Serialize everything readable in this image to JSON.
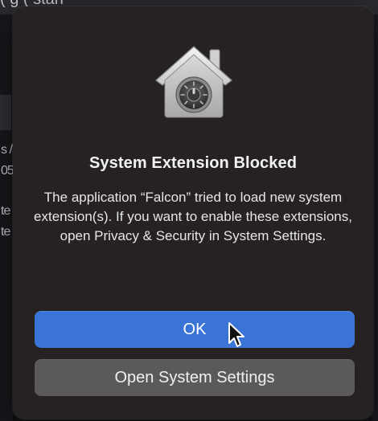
{
  "backdrop": {
    "left_text_lines": [
      "s /",
      "05",
      "te",
      "te"
    ],
    "top_glyphs": "(    g    (   stan"
  },
  "dialog": {
    "icon": "security-house-lock-icon",
    "title": "System Extension Blocked",
    "message": "The application “Falcon” tried to load new system extension(s). If you want to enable these extensions, open Privacy & Security in System Settings.",
    "buttons": {
      "ok_label": "OK",
      "open_settings_label": "Open System Settings"
    }
  },
  "colors": {
    "dialog_bg": "#272222",
    "primary_button": "#3b74d7",
    "secondary_button": "#5c5959",
    "title_text": "#f2f2f2",
    "body_text": "#e6e6e6"
  },
  "cursor": {
    "icon": "arrow-cursor-icon"
  }
}
